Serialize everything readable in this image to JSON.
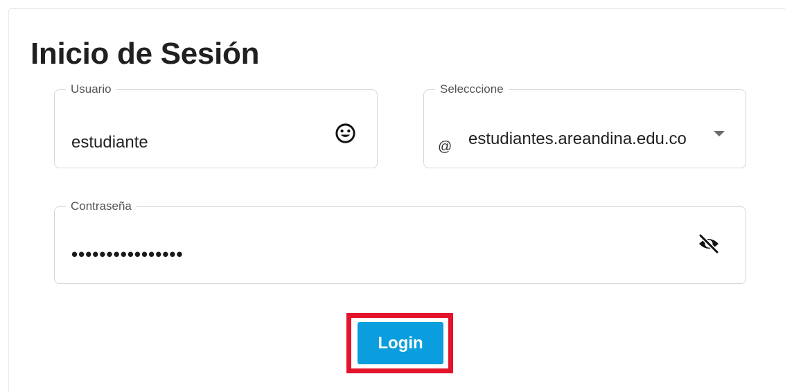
{
  "page": {
    "title": "Inicio de Sesión"
  },
  "form": {
    "user": {
      "label": "Usuario",
      "value": "estudiante",
      "icon": "smiley-icon"
    },
    "domain": {
      "label": "Selecccione",
      "prefix": "@",
      "value": "estudiantes.areandina.edu.co",
      "icon": "dropdown-arrow-icon"
    },
    "password": {
      "label": "Contraseña",
      "value": "••••••••••••••••",
      "icon": "eye-off-icon"
    },
    "login_label": "Login"
  },
  "colors": {
    "button": "#0b9ede",
    "highlight": "#e4132c",
    "border": "#d6d6d6"
  }
}
